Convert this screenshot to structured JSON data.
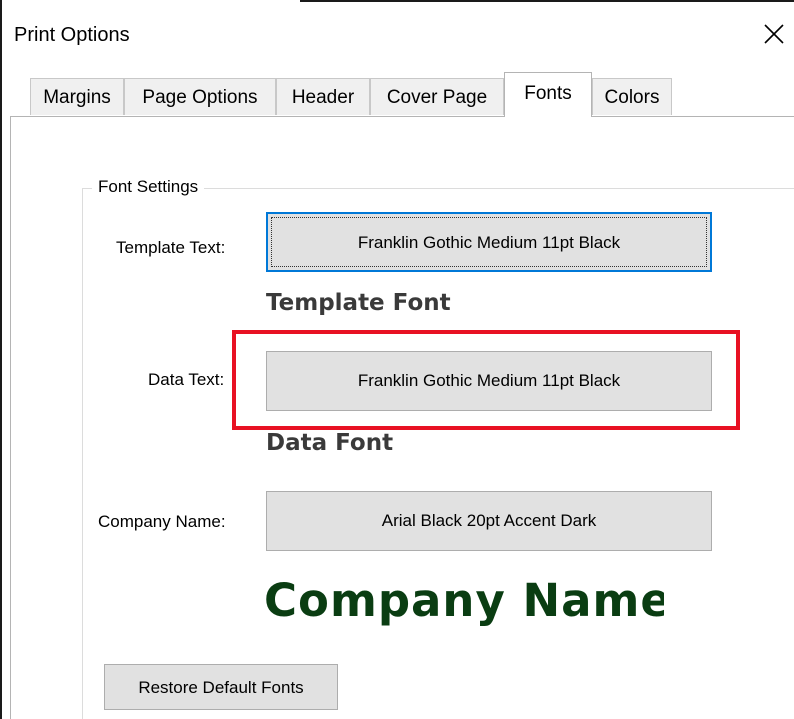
{
  "window": {
    "title": "Print Options",
    "close_icon": "close-icon"
  },
  "tabs": [
    {
      "label": "Margins",
      "active": false
    },
    {
      "label": "Page Options",
      "active": false
    },
    {
      "label": "Header",
      "active": false
    },
    {
      "label": "Cover Page",
      "active": false
    },
    {
      "label": "Fonts",
      "active": true
    },
    {
      "label": "Colors",
      "active": false
    }
  ],
  "font_settings": {
    "group_title": "Font Settings",
    "template": {
      "label": "Template Text:",
      "button": "Franklin Gothic Medium 11pt Black",
      "sample": "Template Font"
    },
    "data": {
      "label": "Data Text:",
      "button": "Franklin Gothic Medium 11pt Black",
      "sample": "Data Font"
    },
    "company": {
      "label": "Company Name:",
      "button": "Arial Black 20pt Accent Dark",
      "sample": "Company Name"
    },
    "restore_button": "Restore Default Fonts"
  },
  "colors": {
    "focus": "#0078d7",
    "highlight": "#e81123",
    "company_sample": "#0a3d12"
  }
}
